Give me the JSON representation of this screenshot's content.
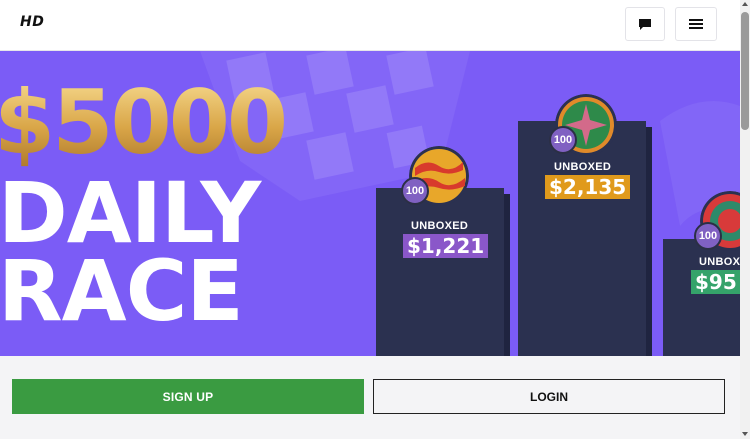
{
  "header": {
    "logo": "HD",
    "chat_icon": "chat-bubble-icon",
    "menu_icon": "hamburger-menu-icon"
  },
  "banner": {
    "amount": "$5000",
    "line1": "DAILY",
    "line2": "RACE",
    "podiums": [
      {
        "label": "UNBOXED",
        "value": "$1,221",
        "badge": "100",
        "tag_color": "#8a57c9"
      },
      {
        "label": "UNBOXED",
        "value": "$2,135",
        "badge": "100",
        "tag_color": "#e09a1c"
      },
      {
        "label": "UNBOX",
        "value": "$95",
        "badge": "100",
        "tag_color": "#35a36a"
      }
    ]
  },
  "actions": {
    "signup_label": "SIGN UP",
    "login_label": "LOGIN"
  },
  "colors": {
    "banner_bg": "#7b5cf6",
    "podium": "#2b3150",
    "signup_bg": "#3a9b41"
  }
}
